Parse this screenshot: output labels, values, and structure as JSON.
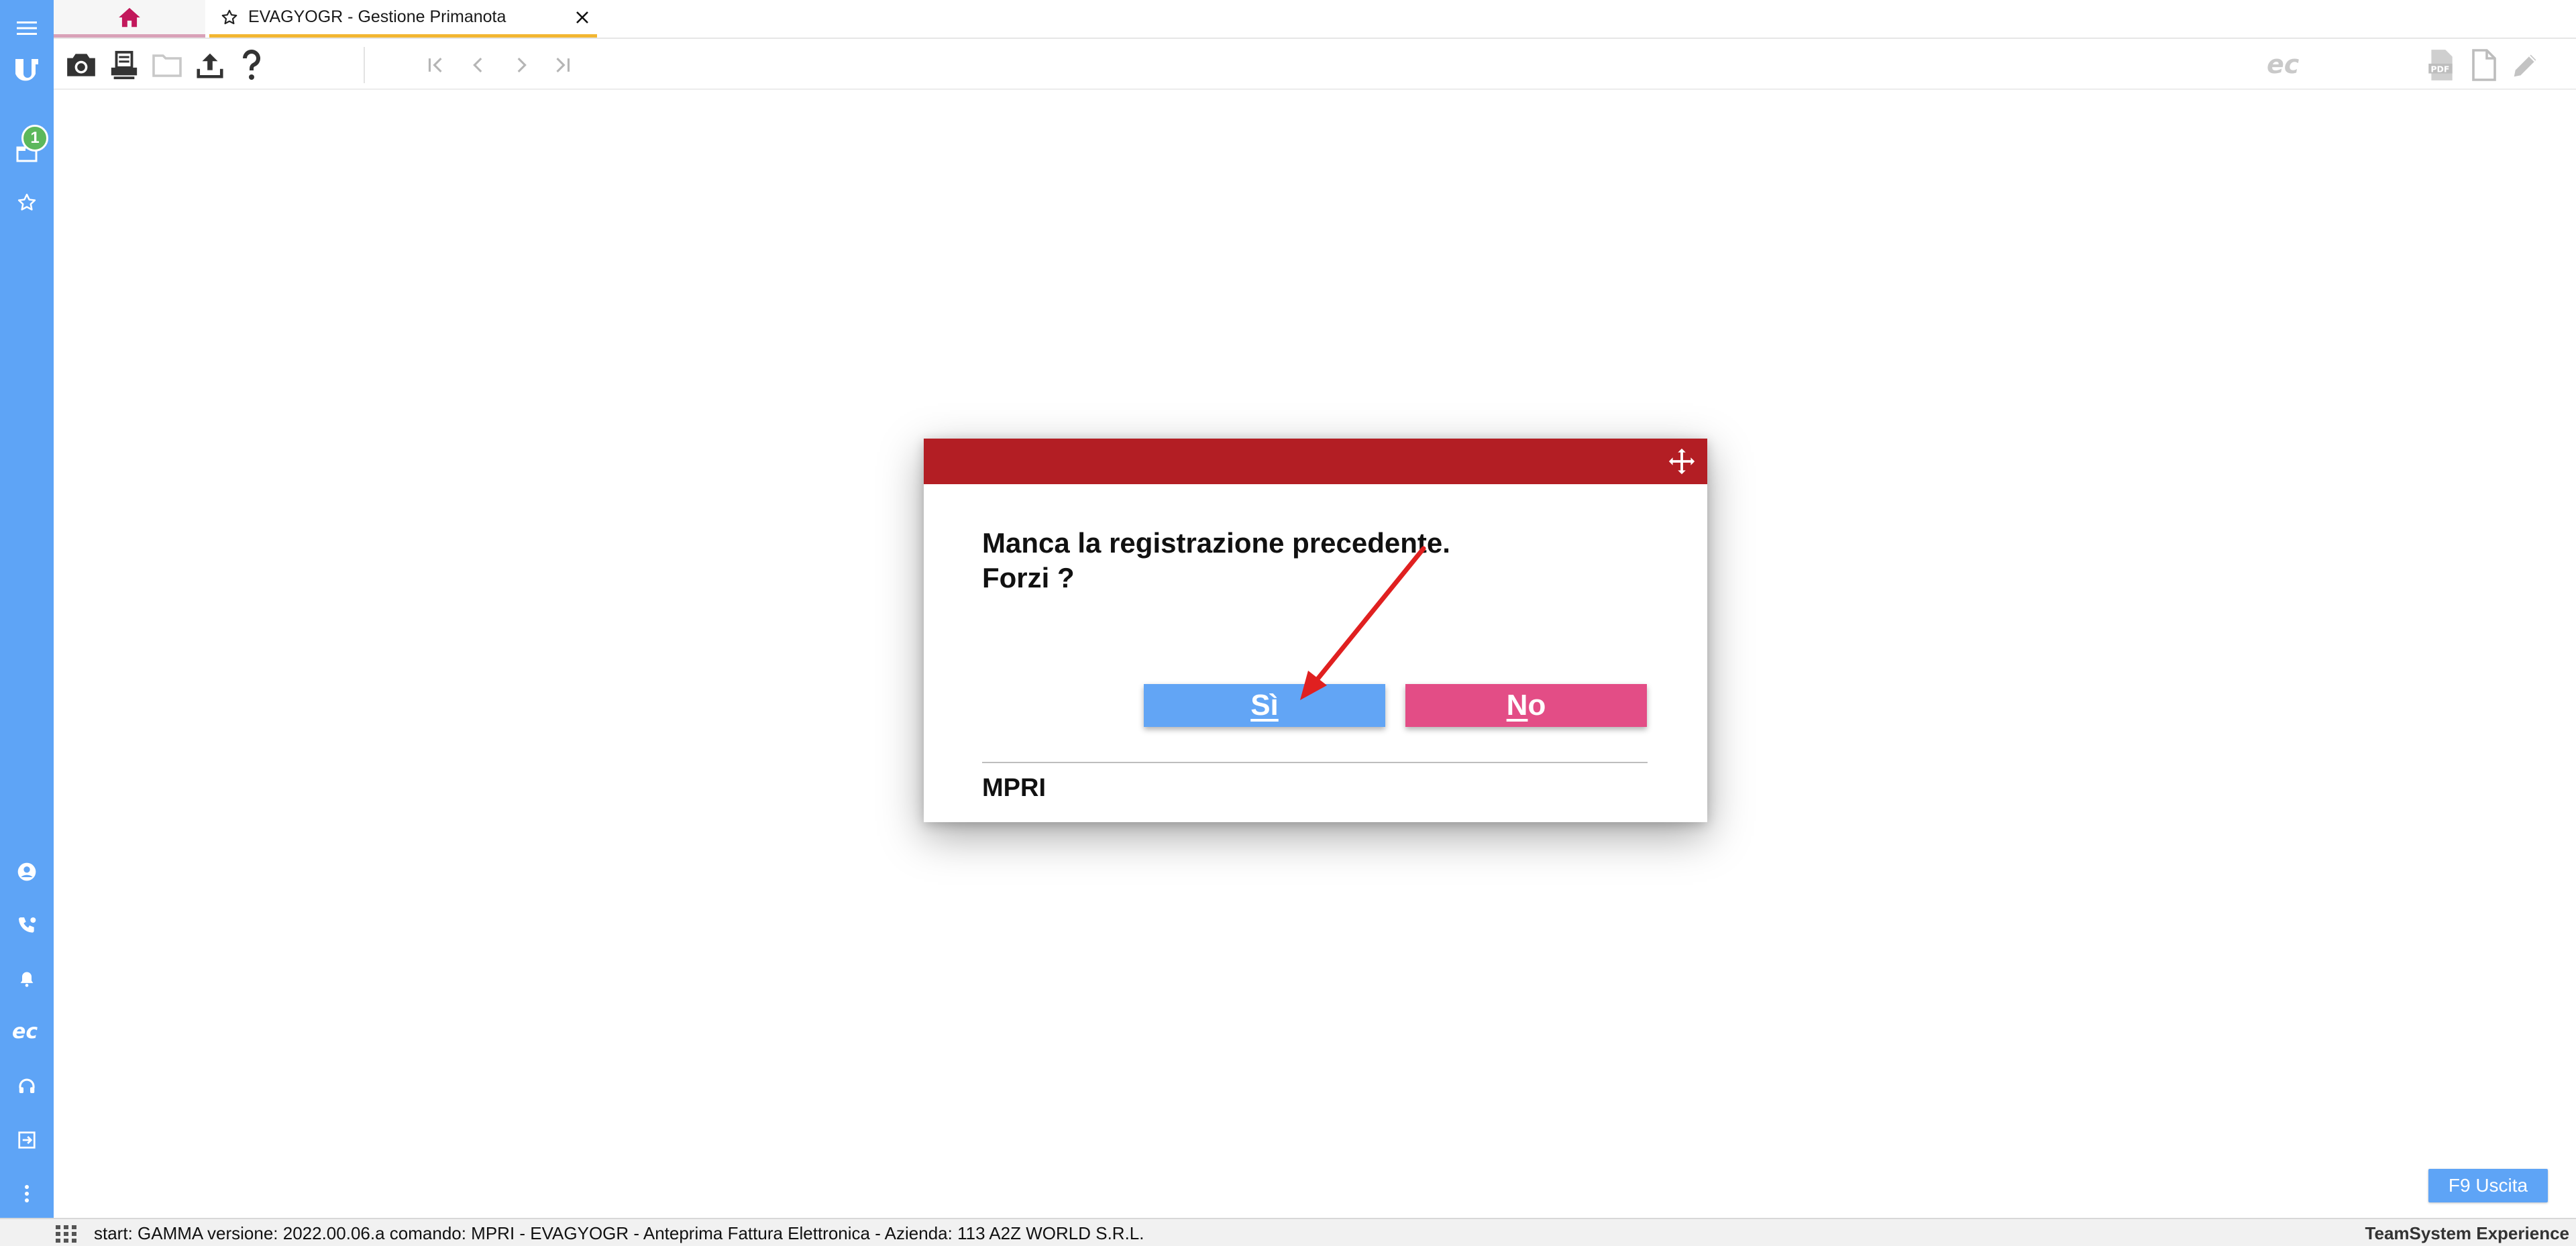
{
  "colors": {
    "sidebar": "#5ea4f6",
    "dialog_header": "#b31e24",
    "yes_button": "#62a5f5",
    "no_button": "#e34d86",
    "home_accent": "#c2185b",
    "active_tab_underline": "#f2b632",
    "badge": "#5cb85c",
    "annotation_arrow": "#e02020"
  },
  "sidebar": {
    "items": [
      {
        "name": "menu",
        "icon": "hamburger-menu-icon"
      },
      {
        "name": "logo",
        "icon": "ts-logo-icon"
      },
      {
        "name": "windows",
        "icon": "windows-icon",
        "badge": "1"
      },
      {
        "name": "favorites",
        "icon": "star-icon"
      },
      {
        "name": "user",
        "icon": "user-icon"
      },
      {
        "name": "phone",
        "icon": "phone-icon"
      },
      {
        "name": "notifications",
        "icon": "bell-icon"
      },
      {
        "name": "ec",
        "icon": "ec-icon"
      },
      {
        "name": "support",
        "icon": "headset-icon"
      },
      {
        "name": "logout",
        "icon": "logout-icon"
      },
      {
        "name": "more",
        "icon": "more-vertical-icon"
      }
    ]
  },
  "tabs": {
    "home_icon": "home-icon",
    "active_label": "EVAGYOGR - Gestione Primanota"
  },
  "toolbar": {
    "left": [
      "camera-icon",
      "printer-icon",
      "folder-icon",
      "upload-icon",
      "help-icon"
    ],
    "nav": [
      "first-page-icon",
      "previous-icon",
      "next-icon",
      "last-page-icon"
    ],
    "right": [
      "ec-icon",
      "pdf-icon",
      "document-icon",
      "edit-icon"
    ]
  },
  "dialog": {
    "message": "Manca la registrazione precedente.\nForzi ?",
    "yes_label": "Sì",
    "no_first": "N",
    "no_rest": "o",
    "code": "MPRI"
  },
  "footer": {
    "exit_label": "F9 Uscita",
    "status_text": "start: GAMMA versione: 2022.00.06.a comando: MPRI - EVAGYOGR - Anteprima Fattura Elettronica - Azienda: 113 A2Z WORLD S.R.L.",
    "brand": "TeamSystem Experience"
  }
}
